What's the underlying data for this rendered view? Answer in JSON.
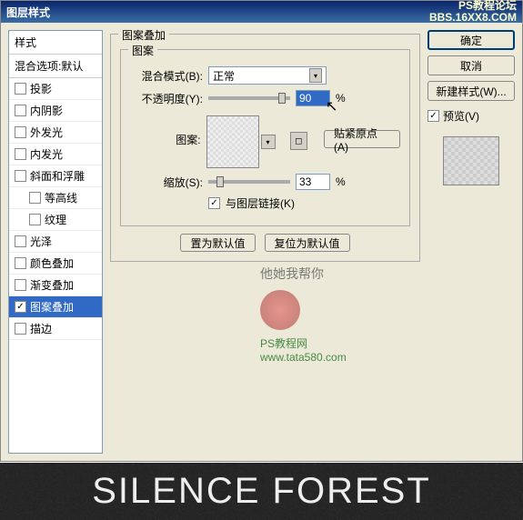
{
  "title": "图层样式",
  "watermark_top": {
    "line1": "PS教程论坛",
    "line2": "BBS.16XX8.COM"
  },
  "styles_panel": {
    "header": "样式",
    "subheader": "混合选项:默认",
    "items": [
      {
        "label": "投影",
        "checked": false,
        "indent": false
      },
      {
        "label": "内阴影",
        "checked": false,
        "indent": false
      },
      {
        "label": "外发光",
        "checked": false,
        "indent": false
      },
      {
        "label": "内发光",
        "checked": false,
        "indent": false
      },
      {
        "label": "斜面和浮雕",
        "checked": false,
        "indent": false
      },
      {
        "label": "等高线",
        "checked": false,
        "indent": true
      },
      {
        "label": "纹理",
        "checked": false,
        "indent": true
      },
      {
        "label": "光泽",
        "checked": false,
        "indent": false
      },
      {
        "label": "颜色叠加",
        "checked": false,
        "indent": false
      },
      {
        "label": "渐变叠加",
        "checked": false,
        "indent": false
      },
      {
        "label": "图案叠加",
        "checked": true,
        "indent": false,
        "selected": true
      },
      {
        "label": "描边",
        "checked": false,
        "indent": false
      }
    ]
  },
  "pattern_overlay": {
    "group_title": "图案叠加",
    "inner_title": "图案",
    "blend_mode_label": "混合模式(B):",
    "blend_mode_value": "正常",
    "opacity_label": "不透明度(Y):",
    "opacity_value": "90",
    "opacity_unit": "%",
    "pattern_label": "图案:",
    "snap_origin": "贴紧原点(A)",
    "scale_label": "缩放(S):",
    "scale_value": "33",
    "scale_unit": "%",
    "link_with_layer": "与图层链接(K)",
    "make_default": "置为默认值",
    "reset_default": "复位为默认值"
  },
  "right_panel": {
    "ok": "确定",
    "cancel": "取消",
    "new_style": "新建样式(W)...",
    "preview": "预览(V)"
  },
  "watermark": {
    "text1": "他她我帮你",
    "text2": "PS教程网",
    "url": "www.tata580.com"
  },
  "bottom_text": "SILENCE FOREST",
  "chart_data": null
}
